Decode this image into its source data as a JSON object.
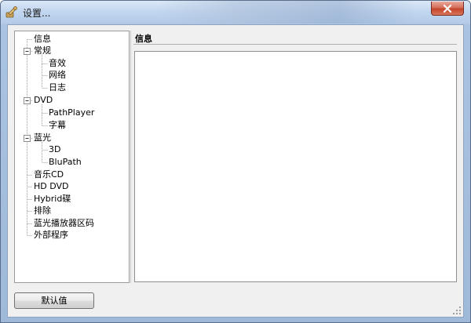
{
  "window": {
    "title": "设置..."
  },
  "tree": {
    "items": [
      {
        "label": "信息"
      },
      {
        "label": "常规"
      },
      {
        "label": "音效"
      },
      {
        "label": "网络"
      },
      {
        "label": "日志"
      },
      {
        "label": "DVD"
      },
      {
        "label": "PathPlayer"
      },
      {
        "label": "字幕"
      },
      {
        "label": "蓝光"
      },
      {
        "label": "3D"
      },
      {
        "label": "BluPath"
      },
      {
        "label": "音乐CD"
      },
      {
        "label": "HD DVD"
      },
      {
        "label": "Hybrid碟"
      },
      {
        "label": "排除"
      },
      {
        "label": "蓝光播放器区码"
      },
      {
        "label": "外部程序"
      }
    ]
  },
  "panel": {
    "header": "信息"
  },
  "footer": {
    "default_button_label": "默认值"
  },
  "icons": {
    "app": "gear-wrench-icon",
    "close": "close-icon",
    "expanded": "minus-box-icon",
    "grip": "resize-grip-icon"
  },
  "colors": {
    "title_gradient_top": "#dbe8f7",
    "close_button": "#c4452b",
    "client_bg": "#f0f0f0"
  }
}
